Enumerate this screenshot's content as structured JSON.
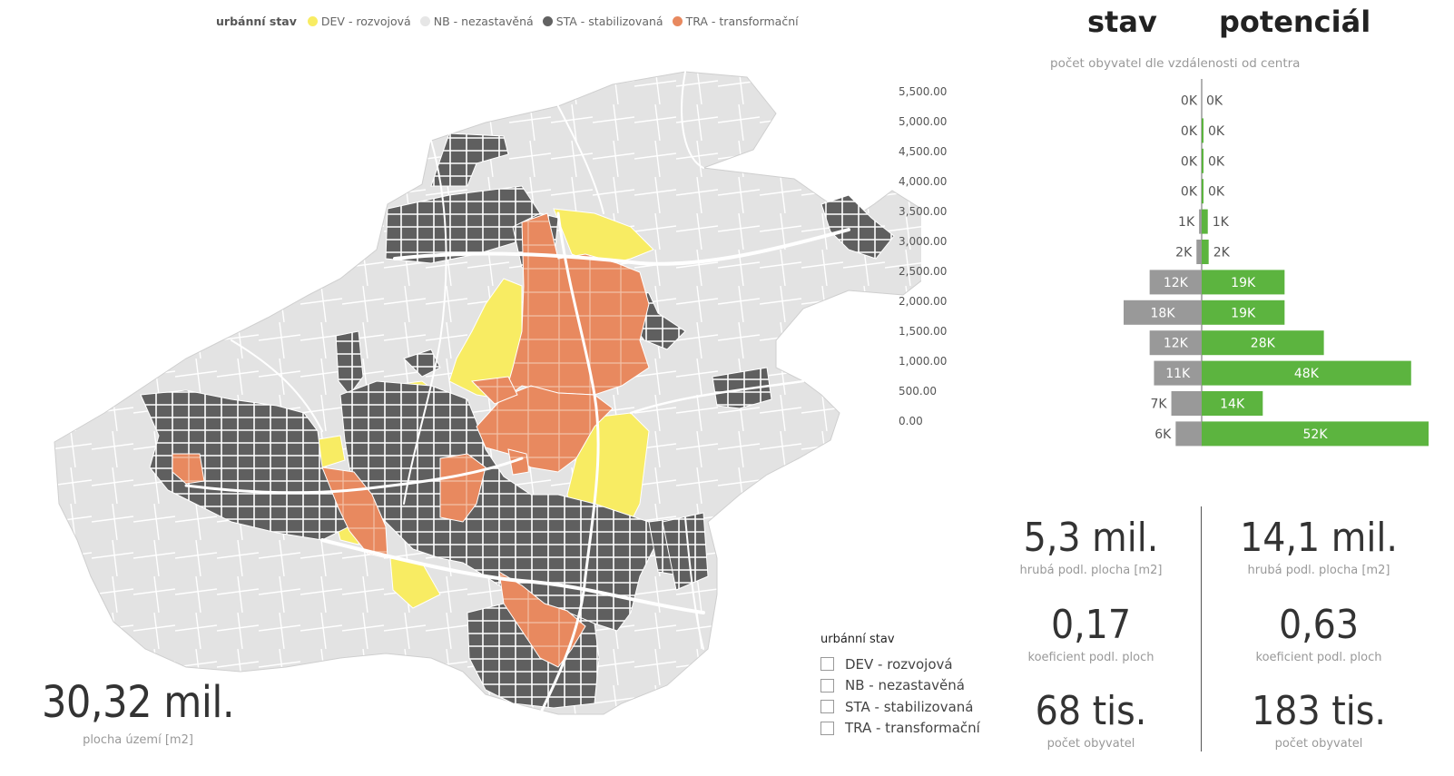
{
  "legend": {
    "title": "urbánní stav",
    "items": [
      {
        "label": "DEV - rozvojová",
        "color": "#F8EC63"
      },
      {
        "label": "NB - nezastavěná",
        "color": "#E6E6E6"
      },
      {
        "label": "STA - stabilizovaná",
        "color": "#626262"
      },
      {
        "label": "TRA - transformační",
        "color": "#E8895F"
      }
    ]
  },
  "map_scale": [
    "5,500.00",
    "5,000.00",
    "4,500.00",
    "4,000.00",
    "3,500.00",
    "3,000.00",
    "2,500.00",
    "2,000.00",
    "1,500.00",
    "1,000.00",
    "500.00",
    "0.00"
  ],
  "area": {
    "value": "30,32 mil.",
    "label": "plocha území [m2]"
  },
  "slicer": {
    "title": "urbánní stav",
    "options": [
      "DEV - rozvojová",
      "NB - nezastavěná",
      "STA - stabilizovaná",
      "TRA - transformační"
    ]
  },
  "headers": {
    "stav": "stav",
    "potencial": "potenciál"
  },
  "chart_data": {
    "type": "bar",
    "title": "počet obyvatel dle vzdálenosti od centra",
    "series": [
      {
        "name": "stav",
        "color": "#999999",
        "values": [
          0,
          0,
          0,
          0,
          0.6,
          1.2,
          12,
          18,
          12,
          11,
          7,
          6
        ],
        "labels": [
          "0K",
          "0K",
          "0K",
          "0K",
          "1K",
          "2K",
          "12K",
          "18K",
          "12K",
          "11K",
          "7K",
          "6K"
        ]
      },
      {
        "name": "potenciál",
        "color": "#5CB43F",
        "values": [
          0,
          0.4,
          0.2,
          0.3,
          1.4,
          1.6,
          19,
          19,
          28,
          48,
          14,
          52
        ],
        "labels": [
          "0K",
          "0K",
          "0K",
          "0K",
          "1K",
          "2K",
          "19K",
          "19K",
          "28K",
          "48K",
          "14K",
          "52K"
        ]
      }
    ]
  },
  "kpis": {
    "stav": [
      {
        "value": "5,3 mil.",
        "label": "hrubá podl. plocha [m2]"
      },
      {
        "value": "0,17",
        "label": "koeficient podl. ploch"
      },
      {
        "value": "68 tis.",
        "label": "počet obyvatel"
      }
    ],
    "potencial": [
      {
        "value": "14,1 mil.",
        "label": "hrubá podl. plocha [m2]"
      },
      {
        "value": "0,63",
        "label": "koeficient podl. ploch"
      },
      {
        "value": "183 tis.",
        "label": "počet obyvatel"
      }
    ]
  }
}
